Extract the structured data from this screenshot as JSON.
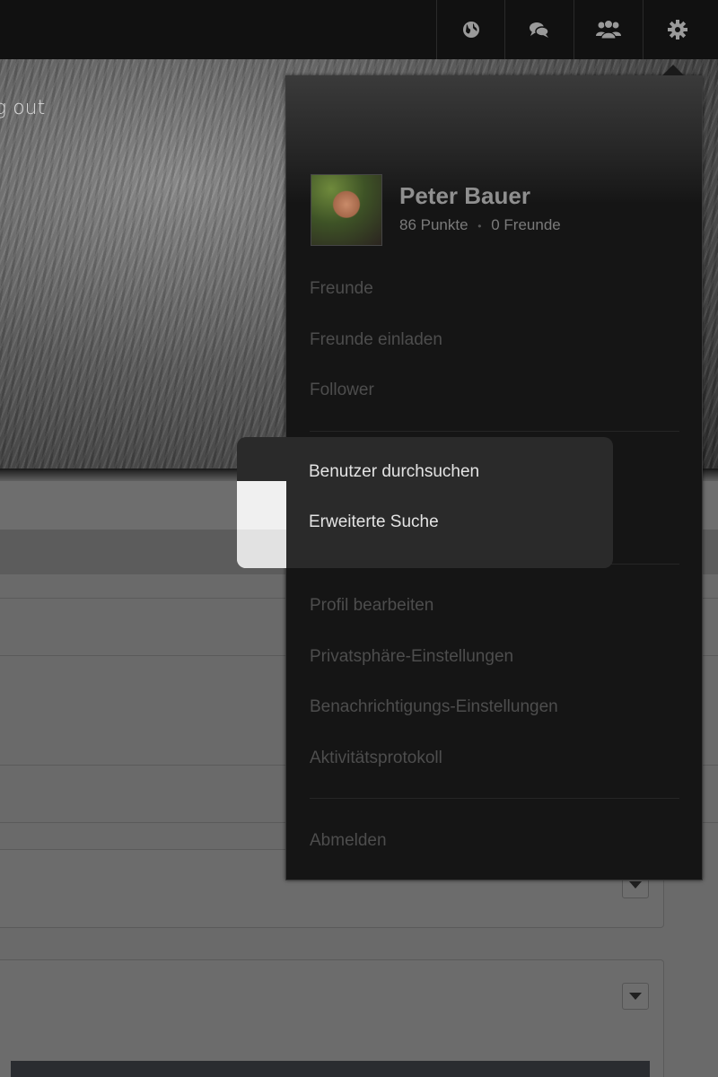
{
  "hero": {
    "text": "g out"
  },
  "nav": {
    "items": [
      {
        "icon": "globe-icon"
      },
      {
        "icon": "chat-icon"
      },
      {
        "icon": "friends-icon"
      },
      {
        "icon": "gear-icon"
      }
    ]
  },
  "profile": {
    "name": "Peter Bauer",
    "points": "86 Punkte",
    "separator": "•",
    "friends": "0 Freunde"
  },
  "menu": {
    "group1": [
      "Freunde",
      "Freunde einladen",
      "Follower"
    ],
    "search": [
      "Benutzer durchsuchen",
      "Erweiterte Suche"
    ],
    "group3": [
      "Profil bearbeiten",
      "Privatsphäre-Einstellungen",
      "Benachrichtigungs-Einstellungen",
      "Aktivitätsprotokoll"
    ],
    "logout": "Abmelden"
  },
  "colors": {
    "topbar": "#111111",
    "dropdown_bg": "#151515",
    "highlight_bg": "#2a2a2a",
    "highlight_text": "#e4e4e4",
    "dim_text": "#4d4d4d"
  }
}
